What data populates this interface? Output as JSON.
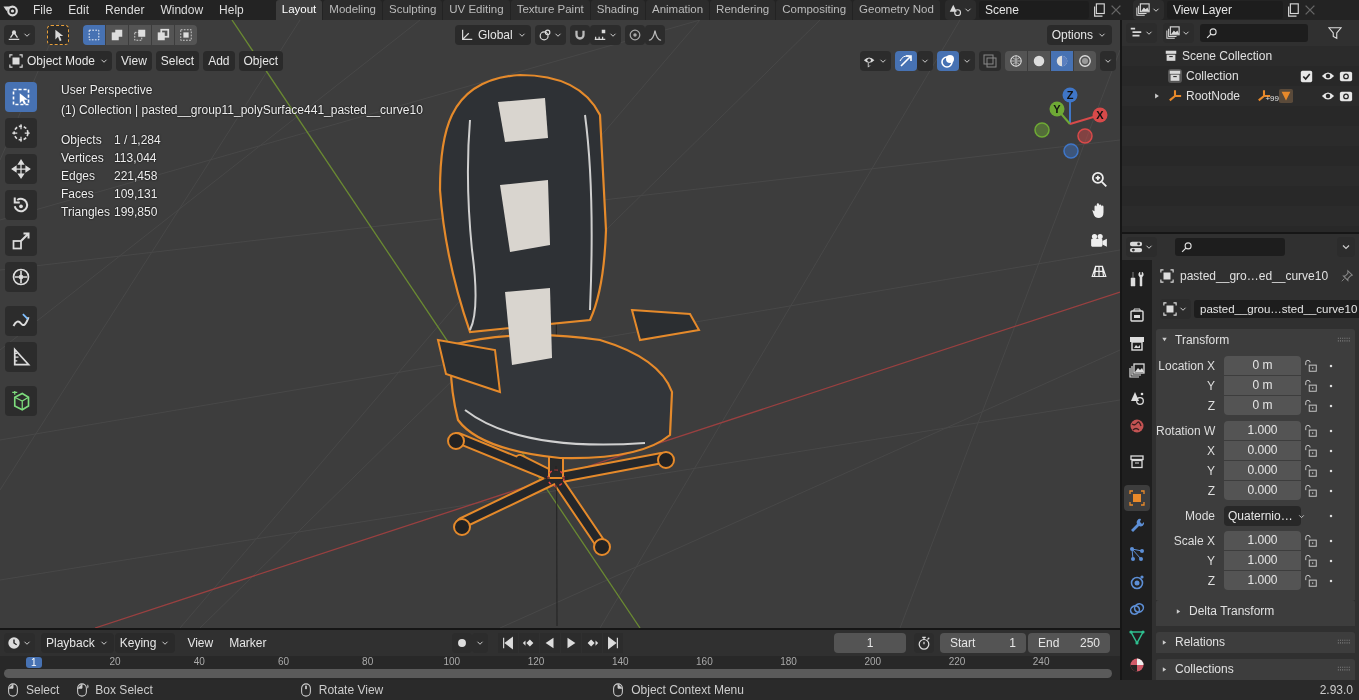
{
  "top_menu": [
    "File",
    "Edit",
    "Render",
    "Window",
    "Help"
  ],
  "workspaces": [
    {
      "label": "Layout",
      "selected": true
    },
    {
      "label": "Modeling",
      "selected": false
    },
    {
      "label": "Sculpting",
      "selected": false
    },
    {
      "label": "UV Editing",
      "selected": false
    },
    {
      "label": "Texture Paint",
      "selected": false
    },
    {
      "label": "Shading",
      "selected": false
    },
    {
      "label": "Animation",
      "selected": false
    },
    {
      "label": "Rendering",
      "selected": false
    },
    {
      "label": "Compositing",
      "selected": false
    },
    {
      "label": "Geometry Nod",
      "selected": false
    }
  ],
  "scene": {
    "name": "Scene"
  },
  "view_layer": {
    "name": "View Layer"
  },
  "tool_header": {
    "selection_modes": [
      {
        "selected": true
      },
      {
        "selected": false
      },
      {
        "selected": false
      },
      {
        "selected": false
      },
      {
        "selected": false
      }
    ],
    "orientation": "Global",
    "options": "Options"
  },
  "viewport_header": {
    "mode": "Object Mode",
    "menus": [
      "View",
      "Select",
      "Add",
      "Object"
    ],
    "toggles": [
      {
        "kind": "gizmo",
        "on": true
      },
      {
        "kind": "overlay",
        "on": true
      },
      {
        "kind": "xray",
        "on": false
      }
    ],
    "shading_modes": [
      {
        "kind": "wire",
        "selected": false
      },
      {
        "kind": "solid",
        "selected": false
      },
      {
        "kind": "material",
        "selected": true
      },
      {
        "kind": "rendered",
        "selected": false
      }
    ]
  },
  "tools": [
    {
      "kind": "select",
      "selected": true
    },
    {
      "kind": "cursor",
      "selected": false
    },
    {
      "kind": "move",
      "selected": false
    },
    {
      "kind": "rotate",
      "selected": false
    },
    {
      "kind": "scale",
      "selected": false
    },
    {
      "kind": "transform",
      "selected": false
    },
    {
      "kind": "annotate",
      "selected": false
    },
    {
      "kind": "measure",
      "selected": false
    },
    {
      "kind": "add-cube",
      "selected": false
    }
  ],
  "viewport": {
    "view_name": "User Perspective",
    "context": "(1) Collection | pasted__group11_polySurface441_pasted__curve10",
    "stats": [
      {
        "label": "Objects",
        "value": "1 / 1,284"
      },
      {
        "label": "Vertices",
        "value": "113,044"
      },
      {
        "label": "Edges",
        "value": "221,458"
      },
      {
        "label": "Faces",
        "value": "109,131"
      },
      {
        "label": "Triangles",
        "value": "199,850"
      }
    ],
    "gizmo_axes": [
      "Z",
      "Y",
      "X"
    ]
  },
  "outliner": {
    "tree": [
      {
        "label": "Scene Collection",
        "kind": "scene",
        "children": [
          {
            "label": "Collection",
            "kind": "collection",
            "checked": true
          },
          {
            "label": "RootNode",
            "kind": "empty",
            "expanded": false,
            "badge": "+99"
          }
        ]
      }
    ]
  },
  "properties": {
    "tabs": [
      {
        "kind": "tool",
        "selected": false
      },
      {
        "kind": "render",
        "selected": false
      },
      {
        "kind": "output",
        "selected": false
      },
      {
        "kind": "view-layer",
        "selected": false
      },
      {
        "kind": "scene",
        "selected": false
      },
      {
        "kind": "world",
        "selected": false
      },
      {
        "kind": "collection",
        "selected": false
      },
      {
        "kind": "object",
        "selected": true
      },
      {
        "kind": "modifiers",
        "selected": false
      },
      {
        "kind": "particles",
        "selected": false
      },
      {
        "kind": "physics",
        "selected": false
      },
      {
        "kind": "constraints",
        "selected": false
      },
      {
        "kind": "data",
        "selected": false
      },
      {
        "kind": "material",
        "selected": false
      }
    ],
    "object_name": "pasted__gro…ed__curve10",
    "data_name": "pasted__grou…sted__curve10",
    "panels": [
      {
        "title": "Transform",
        "kind": "panel",
        "expanded": true,
        "groups": [
          {
            "rows": [
              {
                "label": "Location X",
                "value": "0 m",
                "kind": "number"
              },
              {
                "label": "Y",
                "value": "0 m",
                "kind": "number"
              },
              {
                "label": "Z",
                "value": "0 m",
                "kind": "number"
              }
            ]
          },
          {
            "rows": [
              {
                "label": "Rotation W",
                "value": "1.000",
                "kind": "number"
              },
              {
                "label": "X",
                "value": "0.000",
                "kind": "number"
              },
              {
                "label": "Y",
                "value": "0.000",
                "kind": "number"
              },
              {
                "label": "Z",
                "value": "0.000",
                "kind": "number"
              }
            ]
          },
          {
            "rows": [
              {
                "label": "Mode",
                "value": "Quaternio…",
                "kind": "dropdown"
              }
            ]
          },
          {
            "rows": [
              {
                "label": "Scale X",
                "value": "1.000",
                "kind": "number"
              },
              {
                "label": "Y",
                "value": "1.000",
                "kind": "number"
              },
              {
                "label": "Z",
                "value": "1.000",
                "kind": "number"
              }
            ]
          }
        ]
      },
      {
        "title": "Delta Transform",
        "kind": "subpanel",
        "expanded": false
      },
      {
        "title": "Relations",
        "kind": "panel",
        "expanded": false
      },
      {
        "title": "Collections",
        "kind": "panel",
        "expanded": false
      }
    ]
  },
  "timeline": {
    "menus": [
      {
        "label": "Playback",
        "kind": "dropdown"
      },
      {
        "label": "Keying",
        "kind": "dropdown"
      },
      {
        "label": "View",
        "kind": "menu"
      },
      {
        "label": "Marker",
        "kind": "menu"
      }
    ],
    "current_frame": "1",
    "start_label": "Start",
    "start": "1",
    "end_label": "End",
    "end": "250",
    "playhead": "1",
    "ruler": [
      "20",
      "40",
      "60",
      "80",
      "100",
      "120",
      "140",
      "160",
      "180",
      "200",
      "220",
      "240"
    ]
  },
  "status_bar": {
    "hints": [
      {
        "label": "Select",
        "kind": "left"
      },
      {
        "label": "Box Select",
        "kind": "drag"
      },
      {
        "label": "Rotate View",
        "kind": "middle"
      },
      {
        "label": "Object Context Menu",
        "kind": "right"
      }
    ],
    "version": "2.93.0"
  }
}
